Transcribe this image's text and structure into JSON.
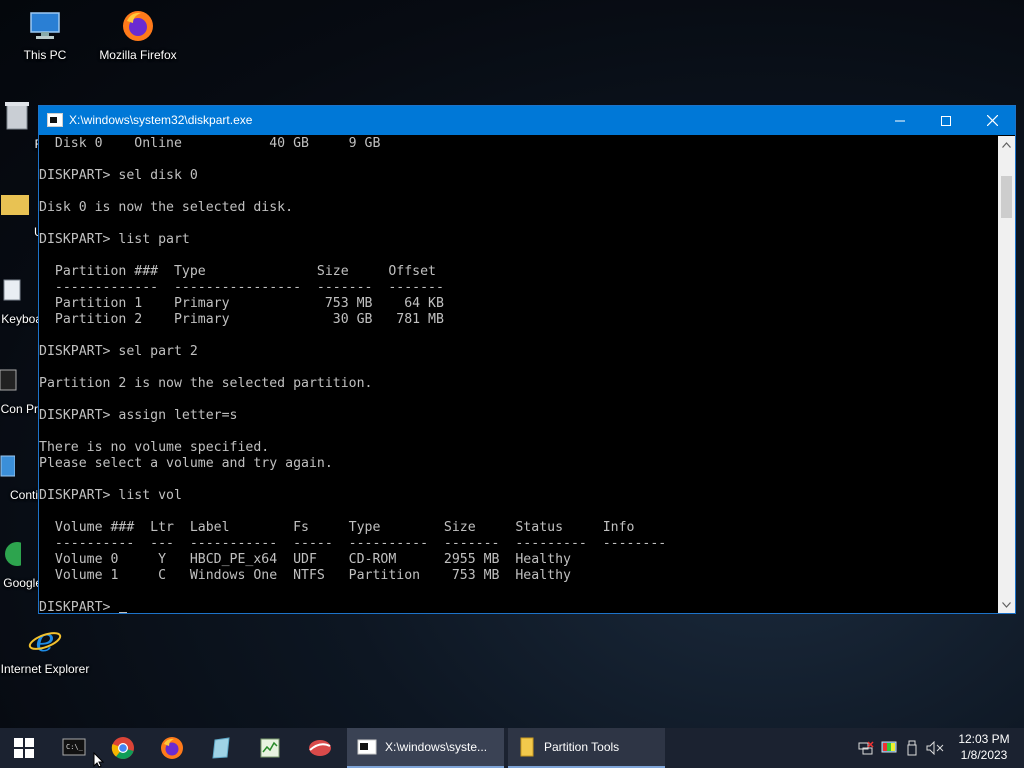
{
  "desktop": {
    "icons": [
      {
        "label": "This PC"
      },
      {
        "label": "Mozilla Firefox"
      },
      {
        "label": "Recy"
      },
      {
        "label": "Ut"
      },
      {
        "label": "Ch Keyboa"
      },
      {
        "label": "Con Pr"
      },
      {
        "label": "Conti"
      },
      {
        "label": "Google"
      },
      {
        "label": "Internet Explorer"
      }
    ]
  },
  "window": {
    "title": "X:\\windows\\system32\\diskpart.exe",
    "console_text": "  Disk 0    Online           40 GB     9 GB\n\nDISKPART> sel disk 0\n\nDisk 0 is now the selected disk.\n\nDISKPART> list part\n\n  Partition ###  Type              Size     Offset\n  -------------  ----------------  -------  -------\n  Partition 1    Primary            753 MB    64 KB\n  Partition 2    Primary             30 GB   781 MB\n\nDISKPART> sel part 2\n\nPartition 2 is now the selected partition.\n\nDISKPART> assign letter=s\n\nThere is no volume specified.\nPlease select a volume and try again.\n\nDISKPART> list vol\n\n  Volume ###  Ltr  Label        Fs     Type        Size     Status     Info\n  ----------  ---  -----------  -----  ----------  -------  ---------  --------\n  Volume 0     Y   HBCD_PE_x64  UDF    CD-ROM      2955 MB  Healthy\n  Volume 1     C   Windows One  NTFS   Partition    753 MB  Healthy\n\nDISKPART> "
  },
  "taskbar": {
    "windows": [
      {
        "label": "X:\\windows\\syste..."
      },
      {
        "label": "Partition Tools"
      }
    ],
    "clock": {
      "time": "12:03 PM",
      "date": "1/8/2023"
    }
  },
  "colors": {
    "titlebar": "#0078d7",
    "taskbar": "#1b2230",
    "console_text": "#c0c0c0"
  }
}
